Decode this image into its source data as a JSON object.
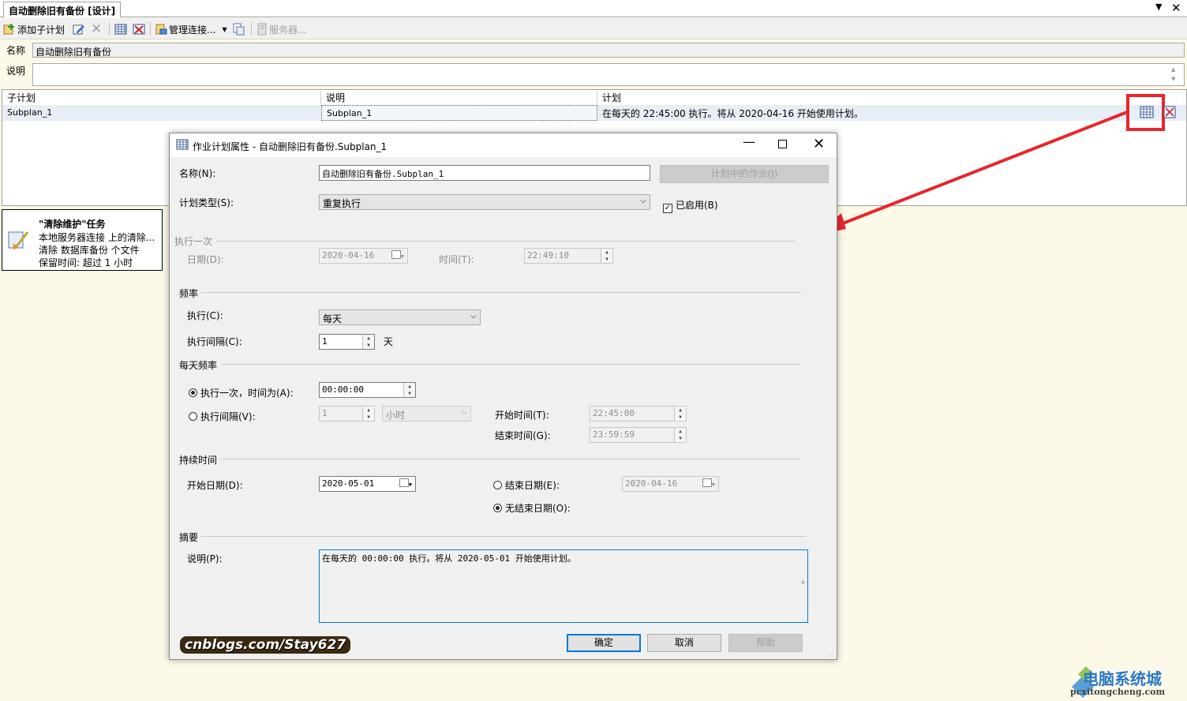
{
  "doc_tab": {
    "title": "自动删除旧有备份 [设计]"
  },
  "toolbar": {
    "add_subplan": "添加子计划",
    "manage_connections": "管理连接...",
    "servers": "服务器..."
  },
  "plan": {
    "name_label": "名称",
    "name_value": "自动删除旧有备份",
    "desc_label": "说明",
    "desc_value": ""
  },
  "grid": {
    "headers": [
      "子计划",
      "说明",
      "计划"
    ],
    "rows": [
      {
        "subplan": "Subplan_1",
        "description": "Subplan_1",
        "schedule": "在每天的 22:45:00 执行。将从 2020-04-16 开始使用计划。"
      }
    ]
  },
  "task": {
    "title": "\"清除维护\"任务",
    "line1": "本地服务器连接 上的清除...",
    "line2": "清除 数据库备份 个文件",
    "line3": "保留时间: 超过 1 小时"
  },
  "dialog": {
    "title": "作业计划属性 - 自动删除旧有备份.Subplan_1",
    "name_label": "名称(N):",
    "name_value": "自动删除旧有备份.Subplan_1",
    "jobs_button": "计划中的作业(J)",
    "type_label": "计划类型(S):",
    "type_value": "重复执行",
    "enabled_label": "已启用(B)",
    "enabled": true,
    "once": {
      "group": "执行一次",
      "date_label": "日期(D):",
      "date_value": "2020-04-16",
      "time_label": "时间(T):",
      "time_value": "22:49:10"
    },
    "frequency": {
      "group": "频率",
      "occurs_label": "执行(C):",
      "occurs_value": "每天",
      "recurs_label": "执行间隔(C):",
      "recurs_value": "1",
      "recurs_unit": "天"
    },
    "daily": {
      "group": "每天频率",
      "once_label": "执行一次，时间为(A):",
      "once_value": "00:00:00",
      "every_label": "执行间隔(V):",
      "every_value": "1",
      "every_unit": "小时",
      "start_label": "开始时间(T):",
      "start_value": "22:45:00",
      "end_label": "结束时间(G):",
      "end_value": "23:59:59"
    },
    "duration": {
      "group": "持续时间",
      "start_label": "开始日期(D):",
      "start_value": "2020-05-01",
      "end_label": "结束日期(E):",
      "end_value": "2020-04-16",
      "no_end_label": "无结束日期(O):"
    },
    "summary": {
      "group": "摘要",
      "desc_label": "说明(P):",
      "desc_value": "在每天的 00:00:00 执行。将从 2020-05-01 开始使用计划。"
    },
    "ok": "确定",
    "cancel": "取消",
    "help": "帮助"
  },
  "watermark": "cnblogs.com/Stay627",
  "site_logo": {
    "name": "电脑系统城",
    "url": "pcxitongcheng.com"
  },
  "colors": {
    "highlight_red": "#e8262c",
    "focus_blue": "#0078d7"
  }
}
